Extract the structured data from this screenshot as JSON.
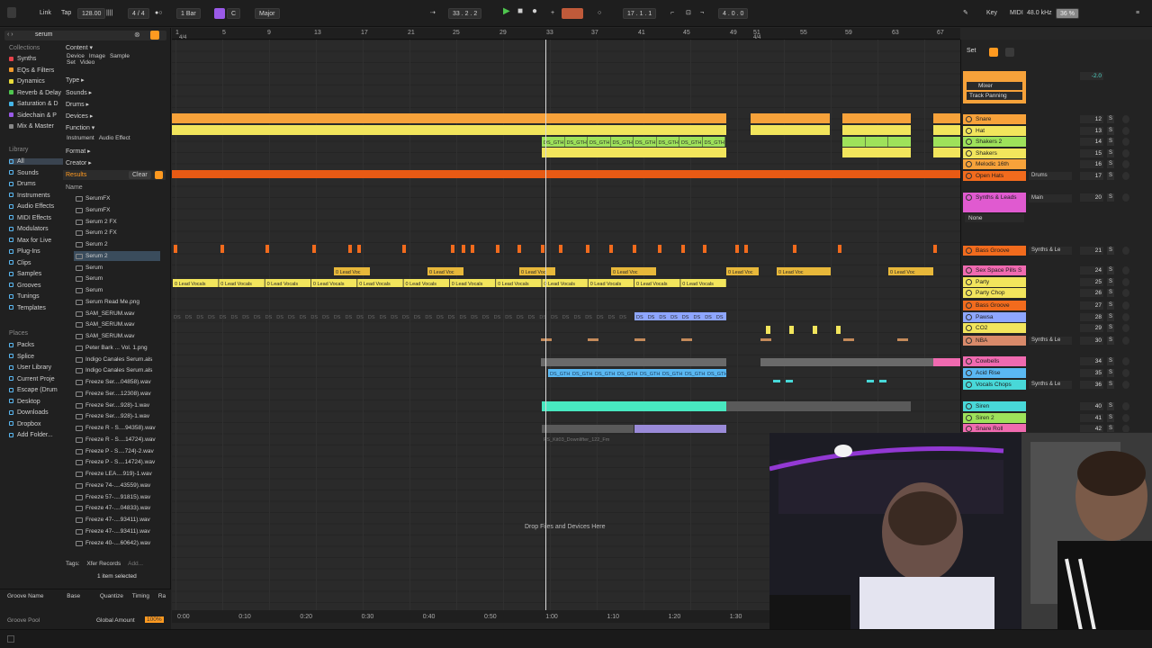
{
  "topbar": {
    "link": "Link",
    "tap": "Tap",
    "tempo": "128.00",
    "time_sig": "4 / 4",
    "quantize": "1 Bar",
    "key": "C",
    "scale": "Major",
    "position": "33 .   2 .   2",
    "loop_start": "17 .   1 .   1",
    "loop_len": "4 .   0 .   0",
    "key_btn": "Key",
    "midi_btn": "MIDI",
    "sample_rate": "48.0 kHz",
    "cpu": "36 %"
  },
  "browser": {
    "search_value": "serum",
    "collections_heading": "Collections",
    "collections": [
      {
        "label": "Synths",
        "color": "#e8424a"
      },
      {
        "label": "EQs & Filters",
        "color": "#f09a2c"
      },
      {
        "label": "Dynamics",
        "color": "#e8dc3a"
      },
      {
        "label": "Reverb & Delay",
        "color": "#4fc74f"
      },
      {
        "label": "Saturation & D",
        "color": "#45b6e8"
      },
      {
        "label": "Sidechain & P",
        "color": "#9a5ae8"
      },
      {
        "label": "Mix & Master",
        "color": "#888888"
      }
    ],
    "library_heading": "Library",
    "library": [
      "All",
      "Sounds",
      "Drums",
      "Instruments",
      "Audio Effects",
      "MIDI Effects",
      "Modulators",
      "Max for Live",
      "Plug-Ins",
      "Clips",
      "Samples",
      "Grooves",
      "Tunings",
      "Templates"
    ],
    "places_heading": "Places",
    "places": [
      "Packs",
      "Splice",
      "User Library",
      "Current Proje",
      "Escape (Drum",
      "Desktop",
      "Downloads",
      "Dropbox",
      "Add Folder..."
    ],
    "filters": [
      {
        "label": "Content ▾"
      },
      {
        "label": "Type ▸"
      },
      {
        "label": "Sounds ▸"
      },
      {
        "label": "Drums ▸"
      },
      {
        "label": "Devices ▸"
      },
      {
        "label": "Function ▾"
      },
      {
        "label": "Format ▸"
      },
      {
        "label": "Creator ▸"
      }
    ],
    "content_tags": [
      "Device",
      "Image",
      "Sample",
      "Set",
      "Video"
    ],
    "function_tags": [
      "Instrument",
      "Audio Effect"
    ],
    "results_label": "Results",
    "clear_label": "Clear",
    "name_header": "Name",
    "results": [
      "SerumFX",
      "SerumFX",
      "Serum 2 FX",
      "Serum 2 FX",
      "Serum 2",
      "Serum 2",
      "Serum",
      "Serum",
      "Serum",
      "Serum Read Me.png",
      "SAM_SERUM.wav",
      "SAM_SERUM.wav",
      "SAM_SERUM.wav",
      "Peter Bark ... Vol. 1.png",
      "Indigo Canales Serum.als",
      "Indigo Canales Serum.als",
      "Freeze Ser....04858).wav",
      "Freeze Ser....12308).wav",
      "Freeze Ser....928)-1.wav",
      "Freeze Ser....928)-1.wav",
      "Freeze R - S....94358).wav",
      "Freeze R - S....14724).wav",
      "Freeze P - S....724)-2.wav",
      "Freeze P - S....14724).wav",
      "Freeze LEA....919)-1.wav",
      "Freeze 74-....43559).wav",
      "Freeze 57-....91815).wav",
      "Freeze 47-....04833).wav",
      "Freeze 47-....93411).wav",
      "Freeze 47-....93411).wav",
      "Freeze 40-....60642).wav"
    ],
    "tags_label": "Tags:",
    "tag_value": "Xfer Records",
    "tag_add": "Add...",
    "selected_info": "1 item selected"
  },
  "groove": {
    "cols": [
      "Groove Name",
      "Base",
      "Quantize",
      "Timing",
      "Ra"
    ],
    "pool_label": "Groove Pool",
    "global_amount_label": "Global Amount",
    "global_amount": "100%"
  },
  "ruler": {
    "bars": [
      "1",
      "5",
      "9",
      "13",
      "17",
      "21",
      "25",
      "29",
      "33",
      "37",
      "41",
      "45",
      "49",
      "51",
      "55",
      "59",
      "63",
      "67"
    ],
    "sig_left": "4/4",
    "sig_mid": "4/4"
  },
  "time_ruler": [
    "0:00",
    "0:10",
    "0:20",
    "0:30",
    "0:40",
    "0:50",
    "1:00",
    "1:10",
    "1:20",
    "1:30"
  ],
  "arrangement": {
    "drop_text": "Drop Files and Devices Here",
    "lead_vocals_clip": "0 Lead Vocals",
    "lead_vocals_short": "0 Lead Voc",
    "ds_clip": "DS_GTH",
    "sample_clip": "FS_Kit03_Downlifter_122_Fm",
    "ds_short": "DS"
  },
  "mixer": {
    "set_label": "Set",
    "mixer_label": "Mixer",
    "track_panning": "Track Panning",
    "none_label": "None",
    "tracks": [
      {
        "name": "Snare",
        "color": "#f7a23a",
        "vol": "12"
      },
      {
        "name": "Hat",
        "color": "#f2e55c",
        "vol": "13"
      },
      {
        "name": "Shakers 2",
        "color": "#9ee25a",
        "vol": "14"
      },
      {
        "name": "Shakers",
        "color": "#f2e55c",
        "vol": "15"
      },
      {
        "name": "Melodic 16th",
        "color": "#f7a23a",
        "vol": "16"
      },
      {
        "name": "Open Hats",
        "color": "#f26b1d",
        "vol": "17"
      },
      {
        "name": "Synths & Leads",
        "color": "#e05ad0",
        "vol": "20"
      },
      {
        "name": "Bass Groove",
        "color": "#f26b1d",
        "vol": "21"
      },
      {
        "name": "Sex Space Pills S",
        "color": "#f06ab0",
        "vol": "24"
      },
      {
        "name": "Party",
        "color": "#f2e55c",
        "vol": "25"
      },
      {
        "name": "Party Chop",
        "color": "#f2e55c",
        "vol": "26"
      },
      {
        "name": "Bass Groove",
        "color": "#f26b1d",
        "vol": "27"
      },
      {
        "name": "Pawsa",
        "color": "#8ea6ff",
        "vol": "28"
      },
      {
        "name": "CO2",
        "color": "#f2e55c",
        "vol": "29"
      },
      {
        "name": "NBA",
        "color": "#d98a6a",
        "vol": "30"
      },
      {
        "name": "Cowbells",
        "color": "#f06ab0",
        "vol": "34"
      },
      {
        "name": "Acid Rise",
        "color": "#5ab8f2",
        "vol": "35"
      },
      {
        "name": "Vocals Chops",
        "color": "#48d8d8",
        "vol": "36"
      },
      {
        "name": "Siren",
        "color": "#48d8d8",
        "vol": "40"
      },
      {
        "name": "Siren 2",
        "color": "#9ee25a",
        "vol": "41"
      },
      {
        "name": "Snare Roll",
        "color": "#f06ab0",
        "vol": "42"
      }
    ],
    "routes": [
      "Drums",
      "Main",
      "Synths & Le",
      "Synths & Le",
      "Synths & Le"
    ],
    "vol_top": "-2.0",
    "solo": "S"
  }
}
